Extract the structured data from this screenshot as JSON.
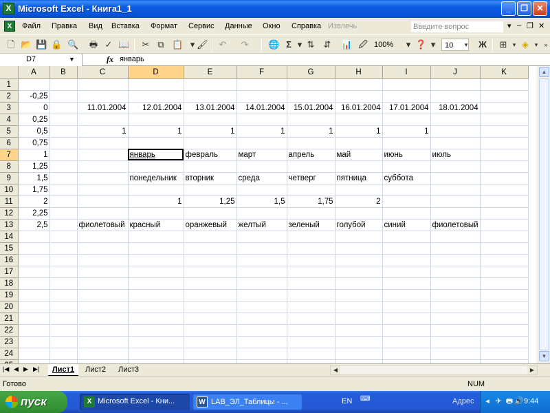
{
  "window": {
    "title": "Microsoft Excel - Книга1_1",
    "app_icon": "X",
    "controls": {
      "minimize": "_",
      "restore": "❐",
      "close": "✕"
    }
  },
  "menu": {
    "items": [
      "Файл",
      "Правка",
      "Вид",
      "Вставка",
      "Формат",
      "Сервис",
      "Данные",
      "Окно",
      "Справка"
    ],
    "disabled_item": "Извлечь",
    "help_placeholder": "Введите вопрос",
    "mdi_controls": {
      "min": "–",
      "restore": "❐",
      "close": "✕"
    }
  },
  "toolbar": {
    "zoom": "100%",
    "font_size": "10",
    "bold_label": "Ж",
    "sum_label": "Σ",
    "icons": [
      "new-icon",
      "open-icon",
      "save-icon",
      "permission-icon",
      "print-preview-icon",
      "print-icon",
      "spelling-icon",
      "cut-icon",
      "copy-icon",
      "paste-icon",
      "format-painter-icon",
      "undo-icon",
      "redo-icon",
      "hyperlink-icon",
      "autosum-icon",
      "sort-ascending-icon",
      "sort-descending-icon",
      "chart-wizard-icon",
      "drawing-icon",
      "help-icon",
      "borders-icon",
      "fill-color-icon"
    ]
  },
  "formula_bar": {
    "name_box": "D7",
    "fx": "fx",
    "value": "январь"
  },
  "sheet": {
    "columns": [
      "A",
      "B",
      "C",
      "D",
      "E",
      "F",
      "G",
      "H",
      "I",
      "J",
      "K"
    ],
    "active_column": "D",
    "active_row": 7,
    "rows": [
      {
        "n": "1",
        "cells": [
          "",
          "",
          "",
          "",
          "",
          "",
          "",
          "",
          "",
          "",
          ""
        ]
      },
      {
        "n": "2",
        "cells": [
          "-0,25",
          "",
          "",
          "",
          "",
          "",
          "",
          "",
          "",
          "",
          ""
        ]
      },
      {
        "n": "3",
        "cells": [
          "0",
          "",
          "11.01.2004",
          "12.01.2004",
          "13.01.2004",
          "14.01.2004",
          "15.01.2004",
          "16.01.2004",
          "17.01.2004",
          "18.01.2004",
          ""
        ]
      },
      {
        "n": "4",
        "cells": [
          "0,25",
          "",
          "",
          "",
          "",
          "",
          "",
          "",
          "",
          "",
          ""
        ]
      },
      {
        "n": "5",
        "cells": [
          "0,5",
          "",
          "1",
          "1",
          "1",
          "1",
          "1",
          "1",
          "1",
          "",
          ""
        ]
      },
      {
        "n": "6",
        "cells": [
          "0,75",
          "",
          "",
          "",
          "",
          "",
          "",
          "",
          "",
          "",
          ""
        ]
      },
      {
        "n": "7",
        "cells": [
          "1",
          "",
          "",
          "январь",
          "февраль",
          "март",
          "апрель",
          "май",
          "июнь",
          "июль",
          ""
        ]
      },
      {
        "n": "8",
        "cells": [
          "1,25",
          "",
          "",
          "",
          "",
          "",
          "",
          "",
          "",
          "",
          ""
        ]
      },
      {
        "n": "9",
        "cells": [
          "1,5",
          "",
          "",
          "понедельник",
          "вторник",
          "среда",
          "четверг",
          "пятница",
          "суббота",
          "",
          ""
        ]
      },
      {
        "n": "10",
        "cells": [
          "1,75",
          "",
          "",
          "",
          "",
          "",
          "",
          "",
          "",
          "",
          ""
        ]
      },
      {
        "n": "11",
        "cells": [
          "2",
          "",
          "",
          "1",
          "1,25",
          "1,5",
          "1,75",
          "2",
          "",
          "",
          ""
        ]
      },
      {
        "n": "12",
        "cells": [
          "2,25",
          "",
          "",
          "",
          "",
          "",
          "",
          "",
          "",
          "",
          ""
        ]
      },
      {
        "n": "13",
        "cells": [
          "2,5",
          "",
          "фиолетовый",
          "красный",
          "оранжевый",
          "желтый",
          "зеленый",
          "голубой",
          "синий",
          "фиолетовый",
          ""
        ]
      },
      {
        "n": "14",
        "cells": [
          "",
          "",
          "",
          "",
          "",
          "",
          "",
          "",
          "",
          "",
          ""
        ]
      },
      {
        "n": "15",
        "cells": [
          "",
          "",
          "",
          "",
          "",
          "",
          "",
          "",
          "",
          "",
          ""
        ]
      },
      {
        "n": "16",
        "cells": [
          "",
          "",
          "",
          "",
          "",
          "",
          "",
          "",
          "",
          "",
          ""
        ]
      },
      {
        "n": "17",
        "cells": [
          "",
          "",
          "",
          "",
          "",
          "",
          "",
          "",
          "",
          "",
          ""
        ]
      },
      {
        "n": "18",
        "cells": [
          "",
          "",
          "",
          "",
          "",
          "",
          "",
          "",
          "",
          "",
          ""
        ]
      },
      {
        "n": "19",
        "cells": [
          "",
          "",
          "",
          "",
          "",
          "",
          "",
          "",
          "",
          "",
          ""
        ]
      },
      {
        "n": "20",
        "cells": [
          "",
          "",
          "",
          "",
          "",
          "",
          "",
          "",
          "",
          "",
          ""
        ]
      },
      {
        "n": "21",
        "cells": [
          "",
          "",
          "",
          "",
          "",
          "",
          "",
          "",
          "",
          "",
          ""
        ]
      },
      {
        "n": "22",
        "cells": [
          "",
          "",
          "",
          "",
          "",
          "",
          "",
          "",
          "",
          "",
          ""
        ]
      },
      {
        "n": "23",
        "cells": [
          "",
          "",
          "",
          "",
          "",
          "",
          "",
          "",
          "",
          "",
          ""
        ]
      },
      {
        "n": "24",
        "cells": [
          "",
          "",
          "",
          "",
          "",
          "",
          "",
          "",
          "",
          "",
          ""
        ]
      },
      {
        "n": "25",
        "cells": [
          "",
          "",
          "",
          "",
          "",
          "",
          "",
          "",
          "",
          "",
          ""
        ]
      }
    ],
    "tabs": [
      "Лист1",
      "Лист2",
      "Лист3"
    ],
    "active_tab": "Лист1"
  },
  "status": {
    "text": "Готово",
    "num": "NUM"
  },
  "taskbar": {
    "start_label": "пуск",
    "tasks": [
      "Microsoft Excel - Кни...",
      "LAB_ЭЛ_Таблицы - ..."
    ],
    "language": "EN",
    "address_label": "Адрес",
    "clock": "9:44"
  },
  "colors": {
    "titlebar": "#0b5ce4",
    "active_header": "#ffd58c",
    "start_button": "#3a9a3a",
    "taskbar": "#245edb"
  }
}
